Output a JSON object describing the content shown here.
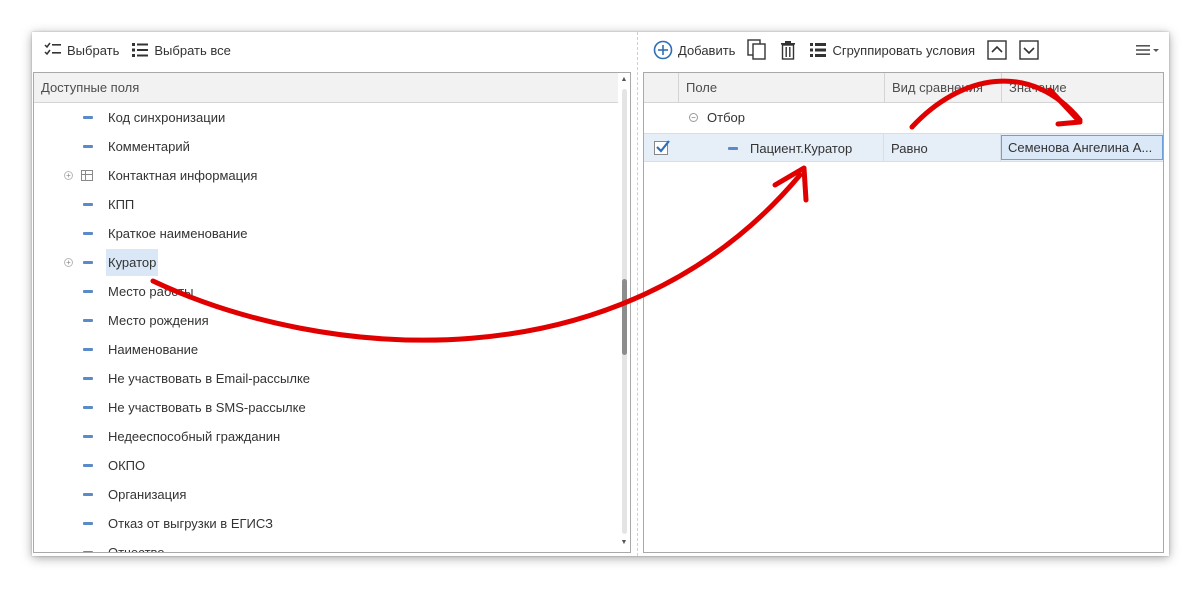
{
  "left_toolbar": {
    "select_label": "Выбрать",
    "select_all_label": "Выбрать все"
  },
  "right_toolbar": {
    "add_label": "Добавить",
    "group_label": "Сгруппировать условия"
  },
  "available_fields": {
    "header": "Доступные поля",
    "items": [
      {
        "label": "Код синхронизации"
      },
      {
        "label": "Комментарий"
      },
      {
        "label": "Контактная информация"
      },
      {
        "label": "КПП"
      },
      {
        "label": "Краткое наименование"
      },
      {
        "label": "Куратор"
      },
      {
        "label": "Место работы"
      },
      {
        "label": "Место рождения"
      },
      {
        "label": "Наименование"
      },
      {
        "label": "Не участвовать в Email-рассылке"
      },
      {
        "label": "Не участвовать в SMS-рассылке"
      },
      {
        "label": "Недееспособный гражданин"
      },
      {
        "label": "ОКПО"
      },
      {
        "label": "Организация"
      },
      {
        "label": "Отказ от выгрузки в ЕГИСЗ"
      },
      {
        "label": "Отчество"
      }
    ]
  },
  "filter_table": {
    "columns": [
      "Поле",
      "Вид сравнения",
      "Значение"
    ],
    "group_label": "Отбор",
    "rows": [
      {
        "field": "Пациент.Куратор",
        "comparison": "Равно",
        "value": "Семенова Ангелина А...",
        "checked": true
      }
    ]
  },
  "colors": {
    "arrow": "#e00000",
    "selection": "#d9e7f7",
    "accent": "#2f6fb6"
  }
}
